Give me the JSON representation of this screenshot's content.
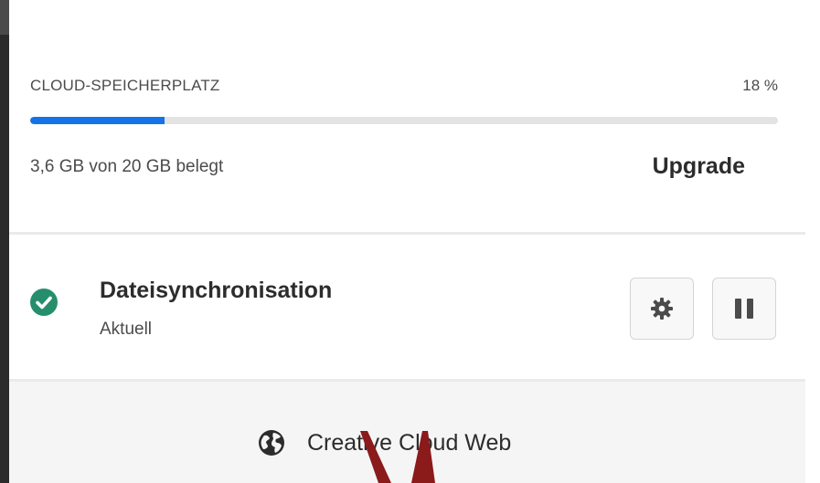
{
  "storage": {
    "label": "CLOUD-SPEICHERPLATZ",
    "percent_text": "18 %",
    "progress_fraction": 0.18,
    "usage_text": "3,6 GB von 20 GB belegt",
    "upgrade_label": "Upgrade",
    "bar_color": "#1473e6",
    "track_color": "#e3e3e3"
  },
  "sync": {
    "title": "Dateisynchronisation",
    "status": "Aktuell",
    "status_color": "#268e6c",
    "status_icon": "checkmark-icon",
    "settings_icon": "gear-icon",
    "pause_icon": "pause-icon"
  },
  "footer": {
    "link_label": "Creative Cloud Web",
    "link_icon": "globe-icon"
  },
  "annotation": {
    "color": "#8b1a1a"
  }
}
